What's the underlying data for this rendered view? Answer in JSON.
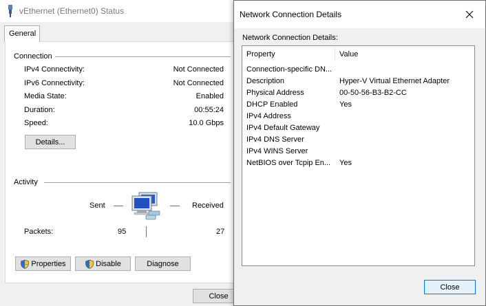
{
  "status_window": {
    "title": "vEthernet (Ethernet0) Status",
    "tab_label": "General",
    "connection": {
      "label": "Connection",
      "rows": [
        {
          "label": "IPv4 Connectivity:",
          "value": "Not Connected"
        },
        {
          "label": "IPv6 Connectivity:",
          "value": "Not Connected"
        },
        {
          "label": "Media State:",
          "value": "Enabled"
        },
        {
          "label": "Duration:",
          "value": "00:55:24"
        },
        {
          "label": "Speed:",
          "value": "10.0 Gbps"
        }
      ],
      "details_button": "Details..."
    },
    "activity": {
      "label": "Activity",
      "sent_label": "Sent",
      "received_label": "Received",
      "packets_label": "Packets:",
      "packets_sent": "95",
      "packets_received": "27"
    },
    "buttons": {
      "properties": "Properties",
      "disable": "Disable",
      "diagnose": "Diagnose",
      "close": "Close"
    }
  },
  "details_window": {
    "title": "Network Connection Details",
    "caption": "Network Connection Details:",
    "columns": {
      "property": "Property",
      "value": "Value"
    },
    "rows": [
      {
        "property": "Connection-specific DN...",
        "value": ""
      },
      {
        "property": "Description",
        "value": "Hyper-V Virtual Ethernet Adapter"
      },
      {
        "property": "Physical Address",
        "value": "00-50-56-B3-B2-CC"
      },
      {
        "property": "DHCP Enabled",
        "value": "Yes"
      },
      {
        "property": "IPv4 Address",
        "value": ""
      },
      {
        "property": "IPv4 Default Gateway",
        "value": ""
      },
      {
        "property": "IPv4 DNS Server",
        "value": ""
      },
      {
        "property": "IPv4 WINS Server",
        "value": ""
      },
      {
        "property": "NetBIOS over Tcpip En...",
        "value": "Yes"
      }
    ],
    "close_button": "Close"
  },
  "icons": {
    "title": "network-adapter-icon",
    "shield": "uac-shield-icon",
    "activity": "network-computers-icon",
    "close": "close-icon"
  },
  "colors": {
    "accent": "#0078d7",
    "button_face": "#e1e1e1",
    "window_bg": "#f0f0f0"
  }
}
